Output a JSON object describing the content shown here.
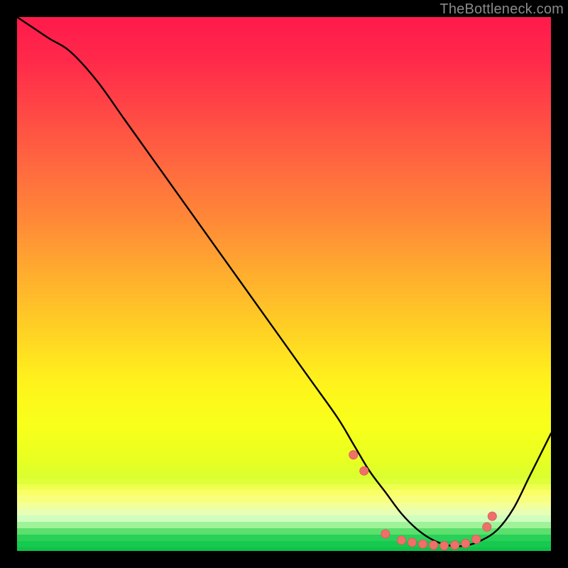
{
  "watermark": "TheBottleneck.com",
  "chart_data": {
    "type": "line",
    "title": "",
    "xlabel": "",
    "ylabel": "",
    "xlim": [
      0,
      100
    ],
    "ylim": [
      0,
      100
    ],
    "series": [
      {
        "name": "curve",
        "x": [
          0,
          3,
          6,
          10,
          15,
          20,
          25,
          30,
          35,
          40,
          45,
          50,
          55,
          60,
          63,
          66,
          69,
          72,
          75,
          78,
          81,
          84,
          87,
          90,
          93,
          96,
          100
        ],
        "y": [
          100,
          98,
          96,
          93.5,
          88,
          81,
          74,
          67,
          60,
          53,
          46,
          39,
          32,
          25,
          20,
          15,
          11,
          7,
          4,
          2,
          1,
          1,
          2,
          4,
          8,
          14,
          22
        ]
      }
    ],
    "markers": {
      "name": "dots",
      "x": [
        63,
        65,
        69,
        72,
        74,
        76,
        78,
        80,
        82,
        84,
        86,
        88,
        89
      ],
      "y": [
        18,
        15,
        3.2,
        2.0,
        1.6,
        1.3,
        1.1,
        1.0,
        1.1,
        1.4,
        2.2,
        4.5,
        6.5
      ]
    },
    "gradient_stops": [
      {
        "pct": 0.0,
        "color": "#ff1b4b"
      },
      {
        "pct": 0.08,
        "color": "#ff2a4a"
      },
      {
        "pct": 0.18,
        "color": "#ff4a45"
      },
      {
        "pct": 0.28,
        "color": "#ff6a3f"
      },
      {
        "pct": 0.38,
        "color": "#ff8a37"
      },
      {
        "pct": 0.48,
        "color": "#ffae2e"
      },
      {
        "pct": 0.58,
        "color": "#ffd024"
      },
      {
        "pct": 0.68,
        "color": "#fff31c"
      },
      {
        "pct": 0.76,
        "color": "#f8ff1a"
      },
      {
        "pct": 0.82,
        "color": "#eaff20"
      },
      {
        "pct": 0.86,
        "color": "#d9ff30"
      },
      {
        "pct": 0.885,
        "color": "#fcff62"
      },
      {
        "pct": 0.905,
        "color": "#f6ff86"
      },
      {
        "pct": 0.92,
        "color": "#edffb0"
      },
      {
        "pct": 0.935,
        "color": "#d4ffc2"
      },
      {
        "pct": 0.945,
        "color": "#aef8a6"
      },
      {
        "pct": 0.955,
        "color": "#78e77a"
      },
      {
        "pct": 0.965,
        "color": "#3fd65f"
      },
      {
        "pct": 0.975,
        "color": "#1fcf55"
      },
      {
        "pct": 0.985,
        "color": "#15c84e"
      },
      {
        "pct": 1.0,
        "color": "#0fbf47"
      }
    ],
    "legend": null,
    "grid": false
  }
}
